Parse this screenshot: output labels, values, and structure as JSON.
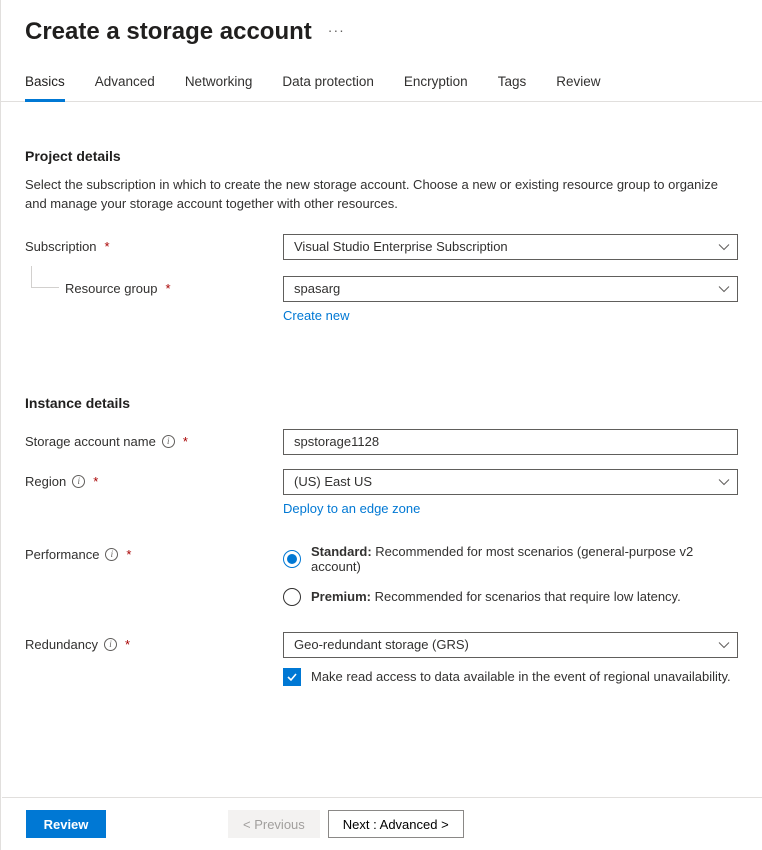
{
  "title": "Create a storage account",
  "tabs": [
    {
      "label": "Basics",
      "active": true
    },
    {
      "label": "Advanced"
    },
    {
      "label": "Networking"
    },
    {
      "label": "Data protection"
    },
    {
      "label": "Encryption"
    },
    {
      "label": "Tags"
    },
    {
      "label": "Review"
    }
  ],
  "sections": {
    "project": {
      "title": "Project details",
      "desc": "Select the subscription in which to create the new storage account. Choose a new or existing resource group to organize and manage your storage account together with other resources.",
      "subscription_label": "Subscription",
      "subscription_value": "Visual Studio Enterprise Subscription",
      "rg_label": "Resource group",
      "rg_value": "spasarg",
      "create_new": "Create new"
    },
    "instance": {
      "title": "Instance details",
      "name_label": "Storage account name",
      "name_value": "spstorage1128",
      "region_label": "Region",
      "region_value": "(US) East US",
      "edge_zone": "Deploy to an edge zone",
      "perf_label": "Performance",
      "perf_standard_title": "Standard:",
      "perf_standard_desc": " Recommended for most scenarios (general-purpose v2 account)",
      "perf_premium_title": "Premium:",
      "perf_premium_desc": " Recommended for scenarios that require low latency.",
      "redundancy_label": "Redundancy",
      "redundancy_value": "Geo-redundant storage (GRS)",
      "ra_option": "Make read access to data available in the event of regional unavailability."
    }
  },
  "footer": {
    "review": "Review",
    "previous": "< Previous",
    "next": "Next : Advanced >"
  }
}
